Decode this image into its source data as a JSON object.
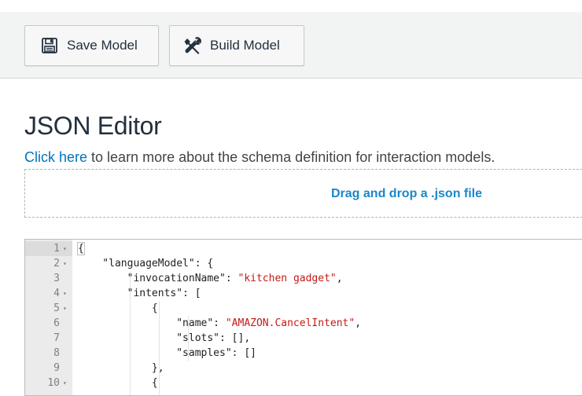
{
  "toolbar": {
    "save_label": "Save Model",
    "build_label": "Build Model"
  },
  "page": {
    "title": "JSON Editor",
    "help_link": "Click here",
    "help_rest": " to learn more about the schema definition for interaction models."
  },
  "dropzone": {
    "label": "Drag and drop a .json file"
  },
  "colors": {
    "link": "#0073bb",
    "drop_text": "#1a87c9",
    "string": "#c41a16",
    "toolbar_bg": "#f2f3f3"
  },
  "editor": {
    "lines": [
      {
        "num": "1",
        "fold": "▾",
        "text": "{"
      },
      {
        "num": "2",
        "fold": "▾",
        "text": "    \"languageModel\": {"
      },
      {
        "num": "3",
        "fold": "",
        "text": "        \"invocationName\": \"kitchen gadget\","
      },
      {
        "num": "4",
        "fold": "▾",
        "text": "        \"intents\": ["
      },
      {
        "num": "5",
        "fold": "▾",
        "text": "            {"
      },
      {
        "num": "6",
        "fold": "",
        "text": "                \"name\": \"AMAZON.CancelIntent\","
      },
      {
        "num": "7",
        "fold": "",
        "text": "                \"slots\": [],"
      },
      {
        "num": "8",
        "fold": "",
        "text": "                \"samples\": []"
      },
      {
        "num": "9",
        "fold": "",
        "text": "            },"
      },
      {
        "num": "10",
        "fold": "▾",
        "text": "            {"
      }
    ]
  }
}
